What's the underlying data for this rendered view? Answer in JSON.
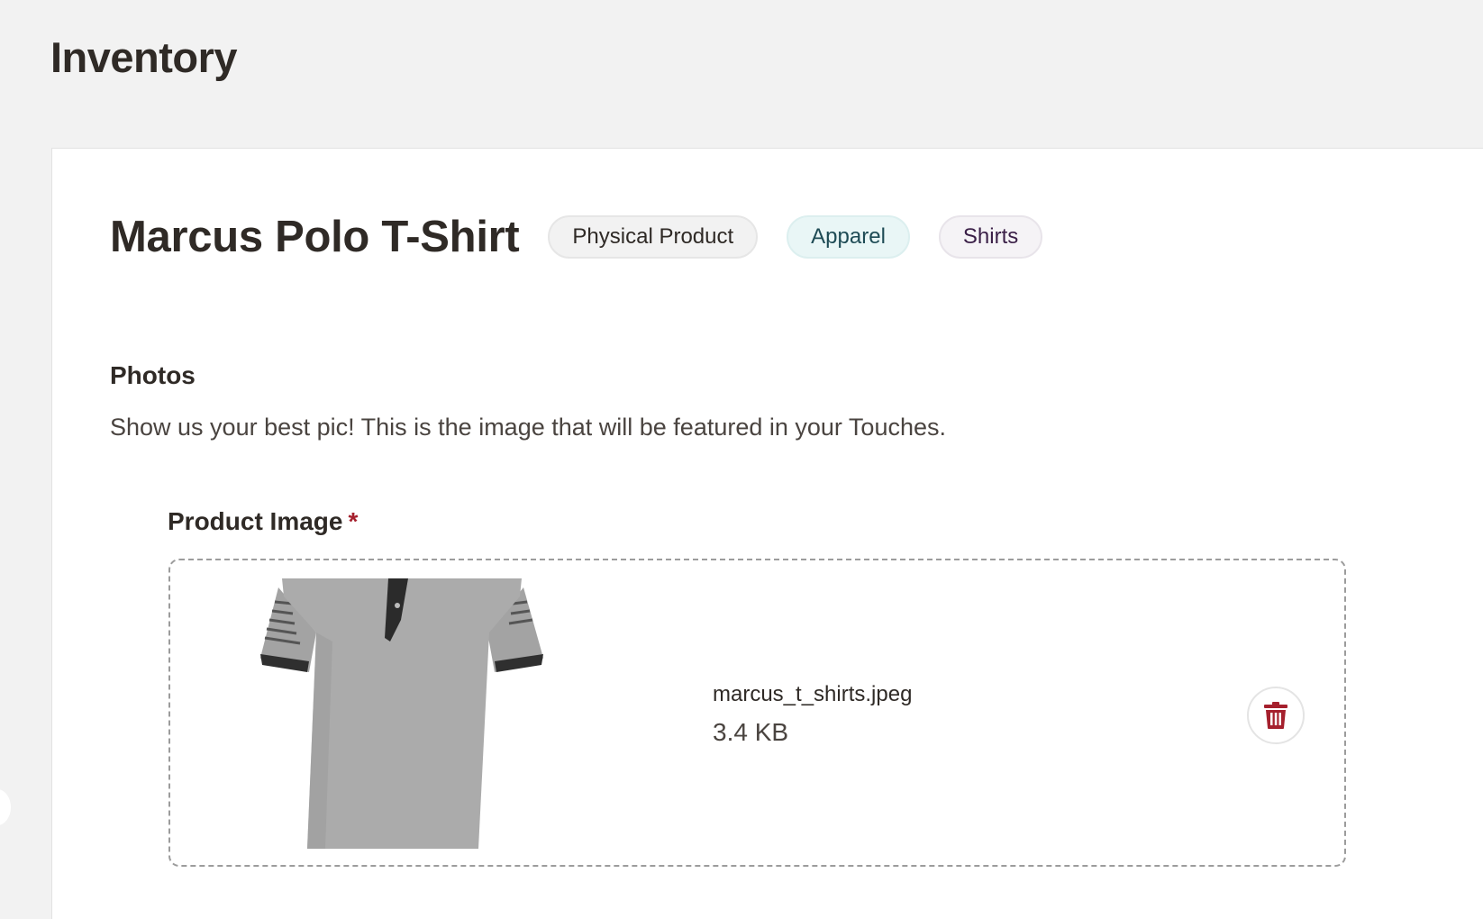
{
  "page": {
    "title": "Inventory"
  },
  "product": {
    "title": "Marcus Polo T-Shirt",
    "tags": [
      {
        "label": "Physical Product"
      },
      {
        "label": "Apparel"
      },
      {
        "label": "Shirts"
      }
    ]
  },
  "photos": {
    "section_title": "Photos",
    "description": "Show us your best pic! This is the image that will be featured in your Touches.",
    "field_label": "Product Image",
    "required_marker": "*",
    "file": {
      "name": "marcus_t_shirts.jpeg",
      "size": "3.4 KB",
      "thumbnail_icon": "polo-shirt-image"
    },
    "delete_icon": "trash-icon"
  },
  "colors": {
    "background": "#f2f2f2",
    "card": "#ffffff",
    "text": "#2f2a26",
    "required": "#a5202d",
    "delete": "#a5202d"
  }
}
